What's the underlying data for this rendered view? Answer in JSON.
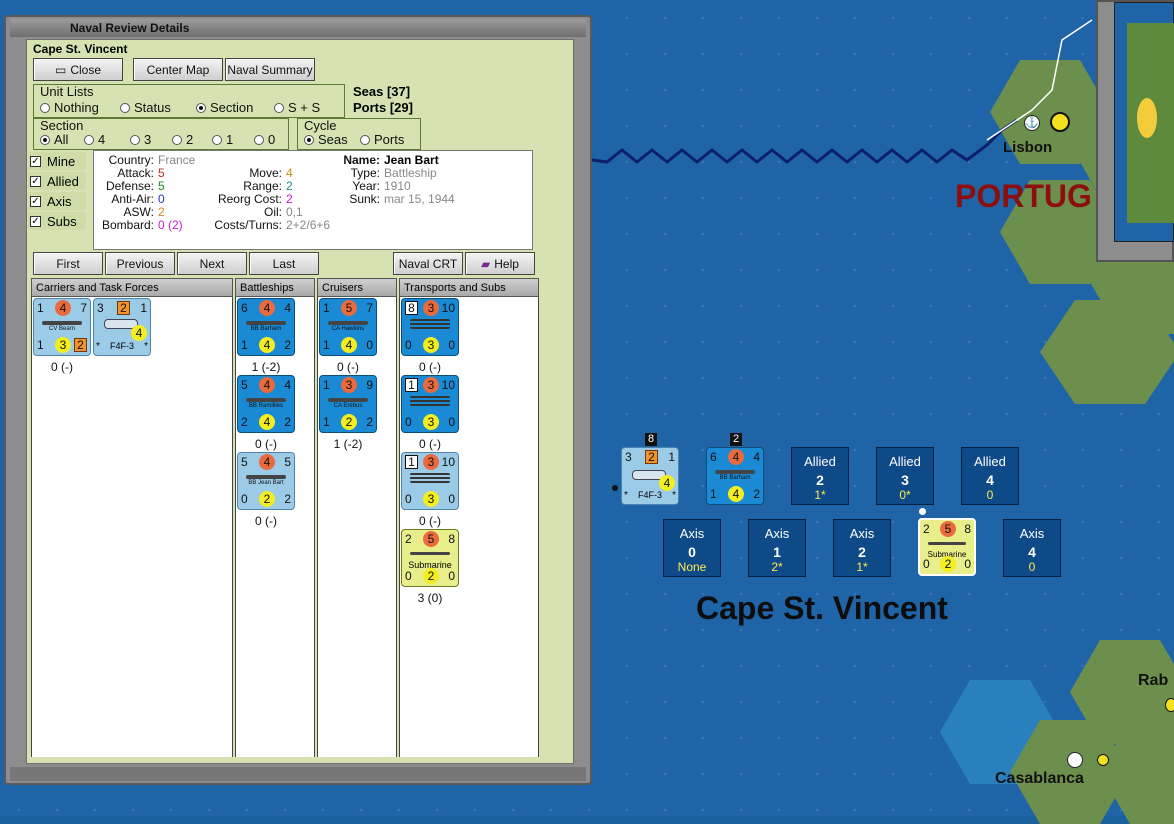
{
  "window": {
    "title": "Naval Review Details",
    "location": "Cape St. Vincent"
  },
  "buttons": {
    "close": "Close",
    "center_map": "Center Map",
    "naval_summary": "Naval Summary",
    "first": "First",
    "previous": "Previous",
    "next": "Next",
    "last": "Last",
    "naval_crt": "Naval CRT",
    "help": "Help"
  },
  "unit_lists": {
    "label": "Unit Lists",
    "options": [
      "Nothing",
      "Status",
      "Section",
      "S + S"
    ],
    "selected": "Section"
  },
  "counts": {
    "seas": "Seas [37]",
    "ports": "Ports [29]"
  },
  "section": {
    "label": "Section",
    "options": [
      "All",
      "4",
      "3",
      "2",
      "1",
      "0"
    ],
    "selected": "All"
  },
  "cycle": {
    "label": "Cycle",
    "options": [
      "Seas",
      "Ports"
    ],
    "selected": "Seas"
  },
  "filters": [
    "Mine",
    "Allied",
    "Axis",
    "Subs"
  ],
  "details": {
    "country_label": "Country:",
    "country": "France",
    "attack_label": "Attack:",
    "attack": "5",
    "defense_label": "Defense:",
    "defense": "5",
    "antiair_label": "Anti-Air:",
    "antiair": "0",
    "asw_label": "ASW:",
    "asw": "2",
    "bombard_label": "Bombard:",
    "bombard": "0 (2)",
    "move_label": "Move:",
    "move": "4",
    "range_label": "Range:",
    "range": "2",
    "reorg_label": "Reorg Cost:",
    "reorg": "2",
    "oil_label": "Oil:",
    "oil": "0,1",
    "costs_label": "Costs/Turns:",
    "costs": "2+2/6+6",
    "name_label": "Name:",
    "name": "Jean Bart",
    "type_label": "Type:",
    "type": "Battleship",
    "year_label": "Year:",
    "year": "1910",
    "sunk_label": "Sunk:",
    "sunk": "mar 15, 1944"
  },
  "columns": [
    "Carriers and Task Forces",
    "Battleships",
    "Cruisers",
    "Transports and Subs"
  ],
  "units": {
    "cv_bearn": {
      "name": "CV Bearn",
      "tl": "1",
      "oc": "4",
      "tr": "7",
      "bl": "1",
      "yc": "3",
      "br": "2",
      "cap": "0 (-)"
    },
    "f4f": {
      "name": "F4F-3",
      "tl": "3",
      "sq": "2",
      "tr": "1",
      "yc": "4",
      "star": "*"
    },
    "bb_barham": {
      "name": "BB Barham",
      "tl": "6",
      "oc": "4",
      "tr": "4",
      "bl": "1",
      "yc": "4",
      "br": "2",
      "cap": "1 (-2)"
    },
    "bb_ramillies": {
      "name": "BB Ramillies",
      "tl": "5",
      "oc": "4",
      "tr": "4",
      "bl": "2",
      "yc": "4",
      "br": "2",
      "cap": "0 (-)"
    },
    "bb_jeanbart": {
      "name": "BB Jean Bart",
      "tl": "5",
      "oc": "4",
      "tr": "5",
      "bl": "0",
      "yc": "2",
      "br": "2",
      "cap": "0 (-)"
    },
    "ca_hawkins": {
      "name": "CA Hawkins",
      "tl": "1",
      "oc": "5",
      "tr": "7",
      "bl": "1",
      "yc": "4",
      "br": "0",
      "cap": "0 (-)"
    },
    "ca_erebus": {
      "name": "CA Erebus",
      "tl": "1",
      "oc": "3",
      "tr": "9",
      "bl": "1",
      "yc": "2",
      "br": "2",
      "cap": "1 (-2)"
    },
    "tr1": {
      "ws": "8",
      "oc": "3",
      "tr": "10",
      "bl": "0",
      "yc": "3",
      "br": "0",
      "cap": "0 (-)"
    },
    "tr2": {
      "ws": "1",
      "oc": "3",
      "tr": "10",
      "bl": "0",
      "yc": "3",
      "br": "0",
      "cap": "0 (-)"
    },
    "tr3": {
      "ws": "1",
      "oc": "3",
      "tr": "10",
      "bl": "0",
      "yc": "3",
      "br": "0",
      "cap": "0 (-)"
    },
    "sub": {
      "name": "Submarine",
      "tl": "2",
      "oc": "5",
      "tr": "8",
      "bl": "0",
      "yc": "2",
      "br": "0",
      "cap": "3 (0)"
    }
  },
  "map": {
    "label_lisbon": "Lisbon",
    "label_portugal": "PORTUG",
    "label_casablanca": "Casablanca",
    "label_rabat": "Rab",
    "sea_area": "Cape St. Vincent",
    "stack_f4f": {
      "count": "8",
      "tl": "3",
      "sq": "2",
      "tr": "1",
      "yc": "4",
      "name": "F4F-3",
      "star": "*"
    },
    "stack_bb": {
      "count": "2",
      "tl": "6",
      "oc": "4",
      "tr": "4",
      "bl": "1",
      "yc": "4",
      "br": "2",
      "name": "BB Barham"
    },
    "allied_slots": [
      {
        "side": "Allied",
        "num": "2",
        "val": "1*"
      },
      {
        "side": "Allied",
        "num": "3",
        "val": "0*"
      },
      {
        "side": "Allied",
        "num": "4",
        "val": "0"
      }
    ],
    "axis_slots": [
      {
        "side": "Axis",
        "num": "0",
        "val": "None"
      },
      {
        "side": "Axis",
        "num": "1",
        "val": "2*"
      },
      {
        "side": "Axis",
        "num": "2",
        "val": "1*"
      },
      {
        "side": "Axis",
        "num": "4",
        "val": "0"
      }
    ],
    "sub_counter": {
      "tl": "2",
      "oc": "5",
      "tr": "8",
      "name": "Submarine",
      "bl": "0",
      "yc": "2",
      "br": "0"
    }
  }
}
